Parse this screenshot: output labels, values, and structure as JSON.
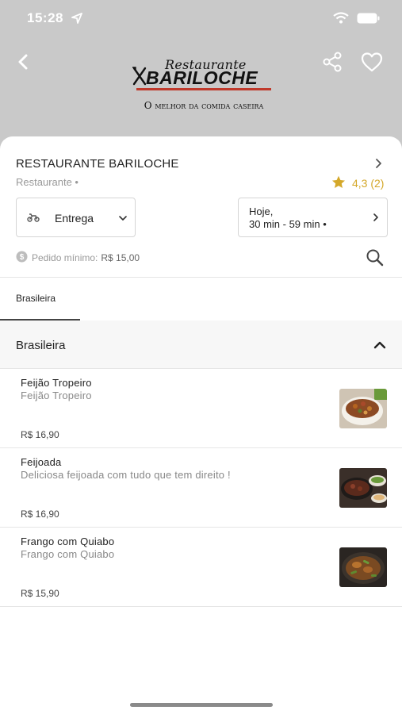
{
  "status_bar": {
    "time": "15:28",
    "icons": [
      "location-arrow-icon",
      "wifi-icon",
      "battery-icon"
    ]
  },
  "nav": {
    "back_icon": "chevron-left-icon",
    "share_icon": "share-icon",
    "favorite_icon": "heart-icon"
  },
  "logo": {
    "top_text": "Restaurante",
    "main_text": "BARILOCHE",
    "tagline": "O melhor da comida caseira"
  },
  "restaurant": {
    "name": "RESTAURANTE BARILOCHE",
    "type": "Restaurante •",
    "rating": "4,3 (2)",
    "rating_color": "#d4a82a"
  },
  "delivery": {
    "mode_label": "Entrega",
    "time_line1": "Hoje,",
    "time_line2": "30 min - 59 min •"
  },
  "min_order": {
    "label": "Pedido mínimo:",
    "value": "R$ 15,00"
  },
  "tabs": [
    {
      "label": "Brasileira",
      "active": true
    }
  ],
  "category": {
    "title": "Brasileira",
    "expanded": true
  },
  "items": [
    {
      "name": "Feijão Tropeiro",
      "description": "Feijão Tropeiro",
      "price": "R$ 16,90"
    },
    {
      "name": "Feijoada",
      "description": "Deliciosa feijoada com tudo que tem direito !",
      "price": "R$ 16,90"
    },
    {
      "name": "Frango com Quiabo",
      "description": "Frango com Quiabo",
      "price": "R$ 15,90"
    }
  ]
}
